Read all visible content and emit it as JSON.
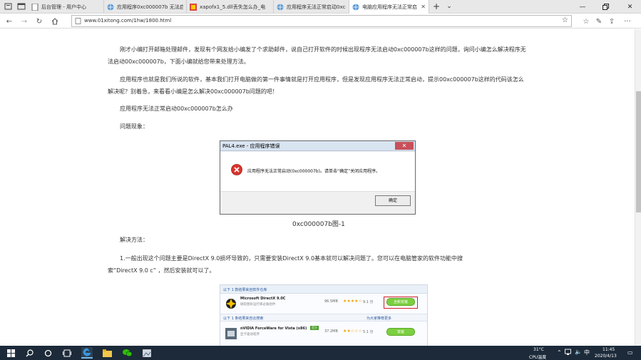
{
  "tabs": [
    {
      "label": "后台管理 - 用户中心",
      "icon": "page-icon"
    },
    {
      "label": "应用程序0xc000007b 无法启",
      "icon": "globe-icon"
    },
    {
      "label": "xapofx1_5.dll丢失怎么办_电",
      "icon": "site-icon"
    },
    {
      "label": "应用程序无法正常启动0xc00",
      "icon": "globe-icon"
    },
    {
      "label": "电脑应用程序无法正常启",
      "icon": "globe-icon",
      "active": true
    }
  ],
  "address": {
    "url": "www.01xitong.com/1hw/1800.html"
  },
  "article": {
    "p1": "刚才小编打开邮箱处理邮件，发现有个网友给小编发了个求助邮件，说自己打开软件的时候出现程序无法启动0xc000007b这样的问题，询问小编怎么解决程序无法启动00xc000007b，下面小编就给您带来处理方法。",
    "p2": "应用程序也就是我们所说的软件，基本我们打开电脑做的第一件事情就是打开应用程序，但是发现应用程序无法正常启动，提示00xc000007b这样的代码该怎么解决呢？别着急，来看看小编是怎么解决00xc000007b问题的吧！",
    "subtitle": "应用程序无法正常启动00xc000007b怎么办",
    "symptom_label": "问题现象：",
    "caption": "0xc000007b图-1",
    "solution_label": "解决方法：",
    "step1_line1": "1.一般出现这个问题主要是DirectX 9.0损坏导致的，只需要安装DirectX 9.0基本就可以解决问题了。您可以在电脑管家的软件功能中搜",
    "step1_line2": "索“DirectX 9.0 c” ，然后安装就可以了。"
  },
  "dialog": {
    "title": "PAL4.exe - 应用程序错误",
    "message": "应用程序无法正常启动(0xc000007b)。请单击“确定”关闭应用程序。",
    "ok_label": "确定"
  },
  "software_list": {
    "header": "以下 1 款结果来自软件仓库",
    "items": [
      {
        "name": "Microsoft DirectX 9.0C",
        "desc": "微软图形运行库必备组件",
        "size": "96.5MB",
        "score": "9.1 分",
        "button": "全新安装"
      },
      {
        "name": "nVIDIA ForceWare for Vista (x86)",
        "desc": "显卡驱动程序",
        "size": "37.2MB",
        "score": "5.1 分",
        "button": "安装",
        "tag": "官方"
      }
    ],
    "subheader": "以下 1 条结果来自云搜索",
    "more": "为大家推荐更多"
  },
  "taskbar": {
    "temp": "31°C",
    "cpu_label": "CPU温度",
    "ime": "中",
    "time": "11:45",
    "date": "2020/4/13"
  },
  "colors": {
    "tabstrip": "#e8e8e8",
    "taskbar": "#1c2a3a",
    "error_red": "#d0202a",
    "install_green": "#7ccf3f"
  }
}
